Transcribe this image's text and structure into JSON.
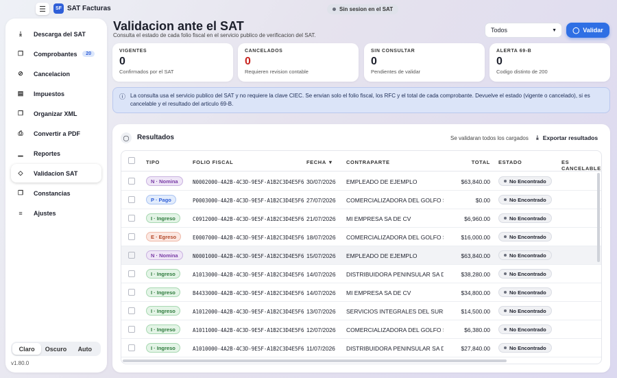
{
  "app": {
    "logo": "SF",
    "name": "SAT Facturas",
    "menu_icon": "hamburger-icon",
    "session": "Sin sesion en el SAT"
  },
  "sidebar": {
    "items": [
      {
        "label": "Descarga del SAT",
        "icon": "download-icon"
      },
      {
        "label": "Comprobantes",
        "icon": "document-icon",
        "badge": "20"
      },
      {
        "label": "Cancelacion",
        "icon": "cancel-icon"
      },
      {
        "label": "Impuestos",
        "icon": "ledger-icon"
      },
      {
        "label": "Organizar XML",
        "icon": "folder-icon"
      },
      {
        "label": "Convertir a PDF",
        "icon": "printer-icon"
      },
      {
        "label": "Reportes",
        "icon": "bar-chart-icon"
      },
      {
        "label": "Validacion SAT",
        "icon": "shield-icon",
        "active": true
      },
      {
        "label": "Constancias",
        "icon": "document-icon"
      },
      {
        "label": "Ajustes",
        "icon": "sliders-icon"
      }
    ],
    "theme": {
      "options": [
        "Claro",
        "Oscuro",
        "Auto"
      ],
      "selected": "Claro"
    },
    "version": "v1.80.0"
  },
  "header": {
    "title": "Validacion ante el SAT",
    "subtitle": "Consulta el estado de cada folio fiscal en el servicio publico de verificacion del SAT.",
    "filter": {
      "selected": "Todos"
    },
    "validate_label": "Validar"
  },
  "stats": [
    {
      "label": "VIGENTES",
      "value": "0",
      "desc": "Confirmados por el SAT",
      "color": "#1c1f2b"
    },
    {
      "label": "CANCELADOS",
      "value": "0",
      "desc": "Requieren revision contable",
      "color": "#c8231e"
    },
    {
      "label": "SIN CONSULTAR",
      "value": "0",
      "desc": "Pendientes de validar",
      "color": "#1c1f2b"
    },
    {
      "label": "ALERTA 69-B",
      "value": "0",
      "desc": "Codigo distinto de 200",
      "color": "#1c1f2b"
    }
  ],
  "info": "La consulta usa el servicio publico del SAT y no requiere la clave CIEC. Se envian solo el folio fiscal, los RFC y el total de cada comprobante. Devuelve el estado (vigente o cancelado), si es cancelable y el resultado del articulo 69-B.",
  "results": {
    "title": "Resultados",
    "note": "Se validaran todos los cargados",
    "export_label": "Exportar resultados",
    "columns": [
      "TIPO",
      "FOLIO FISCAL",
      "FECHA ▼",
      "CONTRAPARTE",
      "TOTAL",
      "ESTADO",
      "ES CANCELABLE"
    ],
    "rows": [
      {
        "tipo": "N · Nomina",
        "k": "N",
        "folio": "N0002000-4A2B-4C3D-9E5F-A1B2C3D4E5F6",
        "fecha": "30/07/2026",
        "contraparte": "EMPLEADO DE EJEMPLO",
        "total": "$63,840.00",
        "estado": "No Encontrado"
      },
      {
        "tipo": "P · Pago",
        "k": "P",
        "folio": "P0003000-4A2B-4C3D-9E5F-A1B2C3D4E5F6",
        "fecha": "27/07/2026",
        "contraparte": "COMERCIALIZADORA DEL GOLFO S...",
        "total": "$0.00",
        "estado": "No Encontrado"
      },
      {
        "tipo": "I · Ingreso",
        "k": "I",
        "folio": "C0912000-4A2B-4C3D-9E5F-A1B2C3D4E5F6",
        "fecha": "21/07/2026",
        "contraparte": "MI EMPRESA SA DE CV",
        "total": "$6,960.00",
        "estado": "No Encontrado"
      },
      {
        "tipo": "E · Egreso",
        "k": "E",
        "folio": "E0007000-4A2B-4C3D-9E5F-A1B2C3D4E5F6",
        "fecha": "18/07/2026",
        "contraparte": "COMERCIALIZADORA DEL GOLFO S...",
        "total": "$16,000.00",
        "estado": "No Encontrado"
      },
      {
        "tipo": "N · Nomina",
        "k": "N",
        "folio": "N0001000-4A2B-4C3D-9E5F-A1B2C3D4E5F6",
        "fecha": "15/07/2026",
        "contraparte": "EMPLEADO DE EJEMPLO",
        "total": "$63,840.00",
        "estado": "No Encontrado",
        "highlight": true
      },
      {
        "tipo": "I · Ingreso",
        "k": "I",
        "folio": "A1013000-4A2B-4C3D-9E5F-A1B2C3D4E5F6",
        "fecha": "14/07/2026",
        "contraparte": "DISTRIBUIDORA PENINSULAR SA DE ...",
        "total": "$38,280.00",
        "estado": "No Encontrado"
      },
      {
        "tipo": "I · Ingreso",
        "k": "I",
        "folio": "B4433000-4A2B-4C3D-9E5F-A1B2C3D4E5F6",
        "fecha": "14/07/2026",
        "contraparte": "MI EMPRESA SA DE CV",
        "total": "$34,800.00",
        "estado": "No Encontrado"
      },
      {
        "tipo": "I · Ingreso",
        "k": "I",
        "folio": "A1012000-4A2B-4C3D-9E5F-A1B2C3D4E5F6",
        "fecha": "13/07/2026",
        "contraparte": "SERVICIOS INTEGRALES DEL SURES...",
        "total": "$14,500.00",
        "estado": "No Encontrado"
      },
      {
        "tipo": "I · Ingreso",
        "k": "I",
        "folio": "A1011000-4A2B-4C3D-9E5F-A1B2C3D4E5F6",
        "fecha": "12/07/2026",
        "contraparte": "COMERCIALIZADORA DEL GOLFO S...",
        "total": "$6,380.00",
        "estado": "No Encontrado"
      },
      {
        "tipo": "I · Ingreso",
        "k": "I",
        "folio": "A1010000-4A2B-4C3D-9E5F-A1B2C3D4E5F6",
        "fecha": "11/07/2026",
        "contraparte": "DISTRIBUIDORA PENINSULAR SA DE ...",
        "total": "$27,840.00",
        "estado": "No Encontrado"
      }
    ]
  }
}
